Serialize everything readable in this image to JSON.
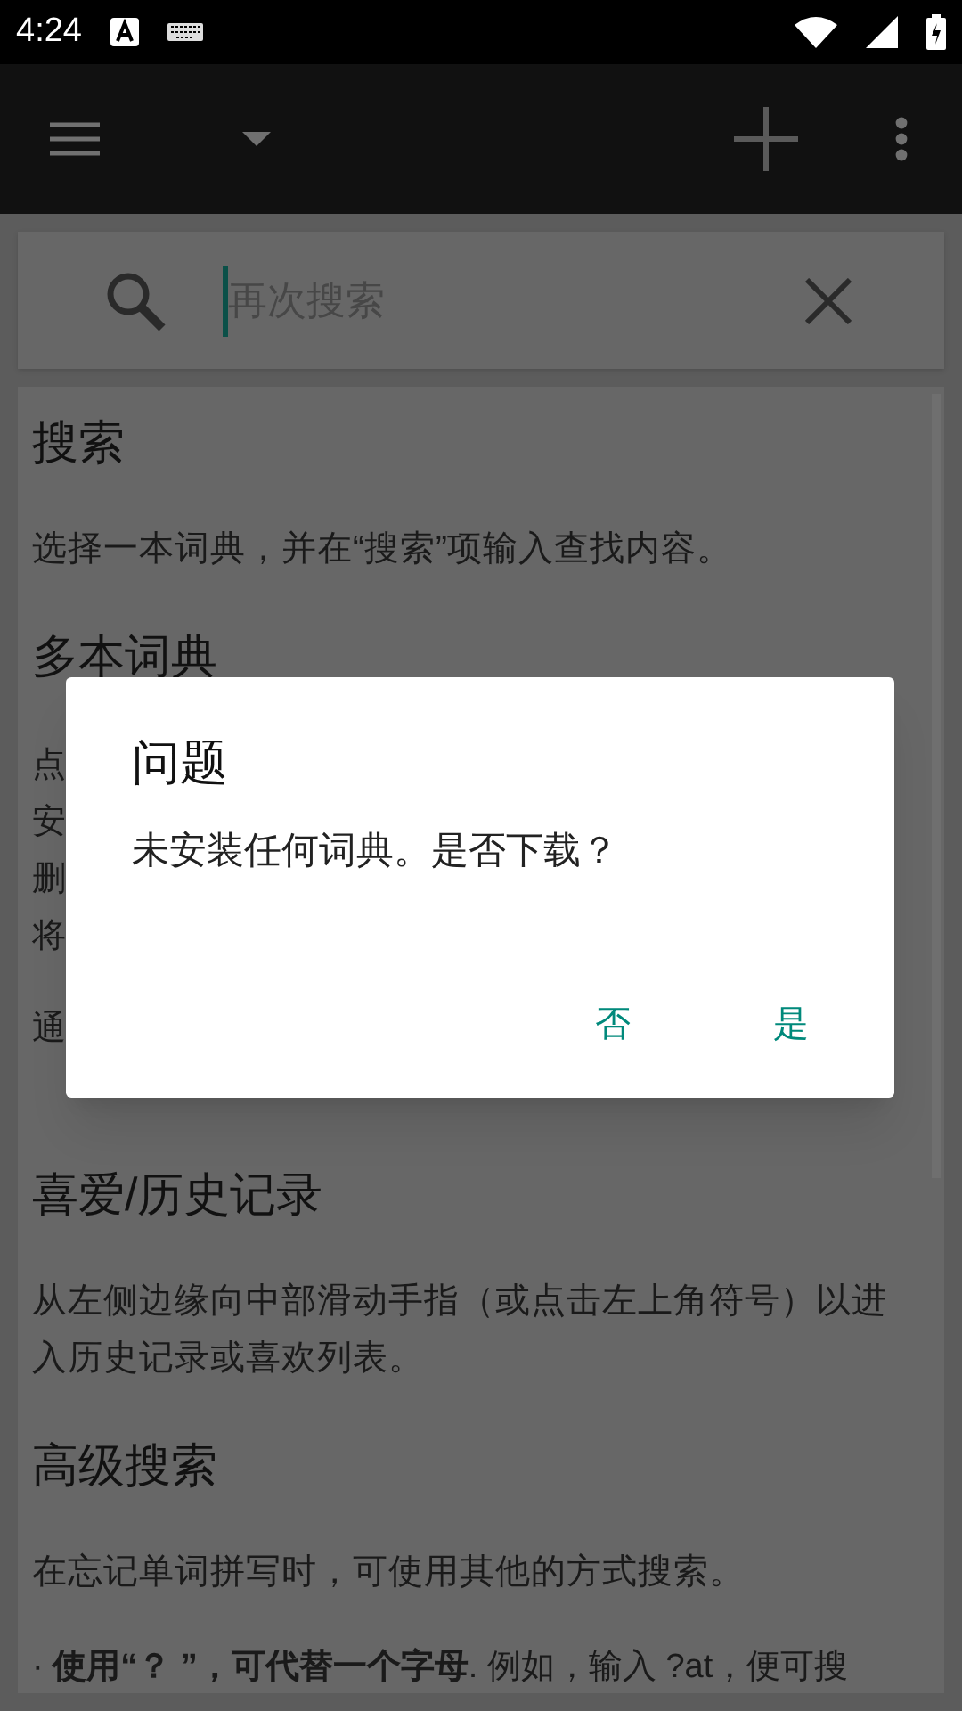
{
  "status_bar": {
    "time": "4:24"
  },
  "search": {
    "placeholder": "再次搜索"
  },
  "help": [
    {
      "heading": "搜索",
      "blocks": [
        {
          "kind": "text",
          "text": "选择一本词典，并在“搜索”项输入查找内容。"
        }
      ]
    },
    {
      "heading": "多本词典",
      "blocks": [
        {
          "kind": "fragments",
          "lines": [
            "点",
            "安",
            "删",
            "将"
          ]
        },
        {
          "kind": "fragments",
          "lines": [
            "通"
          ]
        }
      ]
    },
    {
      "heading": "喜爱/历史记录",
      "blocks": [
        {
          "kind": "text",
          "text": "从左侧边缘向中部滑动手指（或点击左上角符号）以进入历史记录或喜欢列表。"
        }
      ]
    },
    {
      "heading": "高级搜索",
      "blocks": [
        {
          "kind": "text",
          "text": "在忘记单词拼写时，可使用其他的方式搜索。"
        },
        {
          "kind": "bullet",
          "text": "· **使用“？ ”，可代替一个字母**. 例如，输入 ?at，便可搜"
        }
      ]
    }
  ],
  "dialog": {
    "title": "问题",
    "message": "未安装任何词典。是否下载？",
    "buttons": [
      {
        "label": "否"
      },
      {
        "label": "是"
      }
    ]
  }
}
